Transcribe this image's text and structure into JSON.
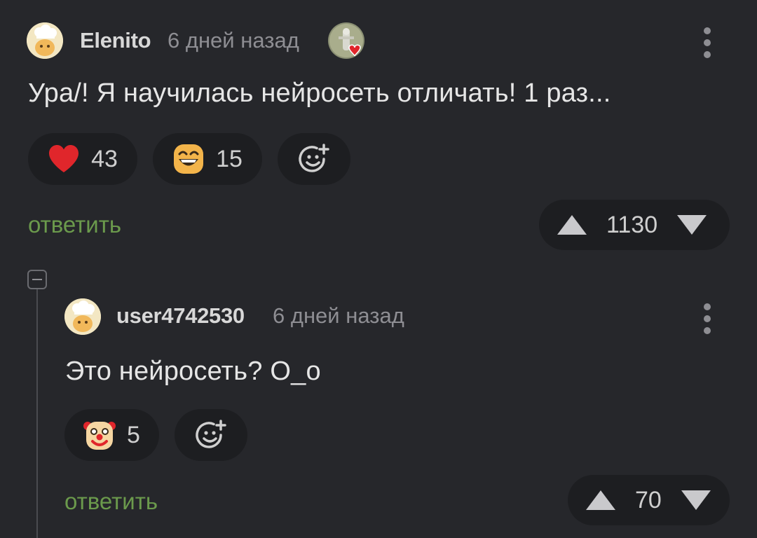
{
  "comments": [
    {
      "username": "Elenito",
      "time": "6 дней назад",
      "text": "Ура/! Я научилась нейросеть отличать! 1 раз...",
      "reactions": [
        {
          "icon": "heart-icon",
          "count": "43"
        },
        {
          "icon": "grinning-face-icon",
          "count": "15"
        }
      ],
      "reply_label": "ответить",
      "score": "1130"
    },
    {
      "username": "user4742530",
      "time": "6 дней назад",
      "text": "Это нейросеть? О_о",
      "reactions": [
        {
          "icon": "clown-face-icon",
          "count": "5"
        }
      ],
      "reply_label": "ответить",
      "score": "70"
    }
  ],
  "colors": {
    "background": "#26272b",
    "pill": "#1d1e21",
    "reply": "#6b9a4c",
    "muted": "#8e8e93",
    "heart": "#e0262b"
  }
}
